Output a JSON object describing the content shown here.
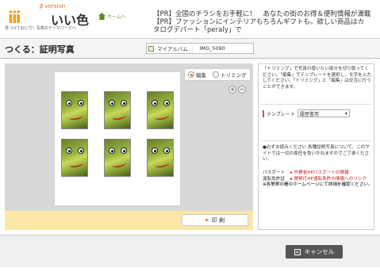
{
  "header": {
    "logo_beta": "β version",
    "logo_mark": "iii",
    "logo_name": "いい色",
    "logo_slogan": "見つけておいで！写真のテーマパークへ",
    "home_link": "ホームへ",
    "pr_line1": "【PR】全国のチラシをお手軽に！　あなたの街のお得＆便利情報が満載",
    "pr_line2": "【PR】ファッションにインテリアもちろんギフトも。欲しい商品はカ",
    "pr_line3": "タログデパート「peraly」で"
  },
  "titlebar": {
    "title": "つくる：証明写真",
    "album_label": "マイアルバム",
    "album_sep": "：",
    "album_file": "IMG_5090"
  },
  "editor": {
    "mode_edit": "編集",
    "mode_trim": "トリミング",
    "zoom_in": "+",
    "zoom_out": "−",
    "print_label": "印 刷"
  },
  "side": {
    "instructions": "「トリミング」で写真の使いたい部分を切り取ってください。「編集」でテンプレートを選択し、文字を入力してください。「トリミング」と「編集」は交互に行うことができます。",
    "template_label": "テンプレート",
    "template_value": "履歴書用",
    "notice": "●必ずお読みください 各種証明写真について、このサイトでは一切の責任を負いかねますのでご了承ください。",
    "links": [
      {
        "label": "パスポート",
        "link": "▸ 外務省HPパスポートの情報"
      },
      {
        "label": "運転免許証",
        "link": "▸ 警察庁HP運転免許の情報へのリンク"
      }
    ],
    "footnote": "※各警察の署のホームページにて詳細を確認ください。"
  },
  "footer": {
    "cancel_label": "キャンセル"
  },
  "colors": {
    "accent_orange": "#e07a10",
    "print_bar": "#fbe7a6",
    "link_red": "#c0201e"
  }
}
